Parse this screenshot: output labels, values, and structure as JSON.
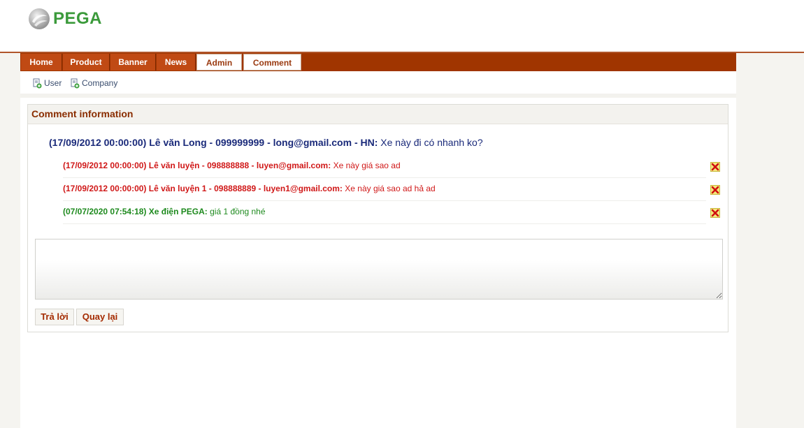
{
  "header": {
    "logo_text": "PEGA"
  },
  "nav": {
    "items": [
      {
        "label": "Home",
        "active": false
      },
      {
        "label": "Product",
        "active": false
      },
      {
        "label": "Banner",
        "active": false
      },
      {
        "label": "News",
        "active": false
      },
      {
        "label": "Admin",
        "active": true
      },
      {
        "label": "Comment",
        "active": true
      }
    ]
  },
  "subnav": {
    "items": [
      {
        "label": "User",
        "icon": "add-user-icon"
      },
      {
        "label": "Company",
        "icon": "add-company-icon"
      }
    ]
  },
  "panel": {
    "title": "Comment information",
    "main_comment": {
      "meta": "(17/09/2012 00:00:00) Lê văn Long - 099999999 - long@gmail.com - HN:",
      "text": " Xe này đi có nhanh ko?"
    },
    "replies": [
      {
        "meta": "(17/09/2012 00:00:00) Lê văn luyện - 098888888 - luyen@gmail.com:",
        "text": " Xe này giá sao ad",
        "color": "#d01818"
      },
      {
        "meta": "(17/09/2012 00:00:00) Lê văn luyện 1 - 098888889 - luyen1@gmail.com:",
        "text": " Xe này giá sao ad hả ad",
        "color": "#d01818"
      },
      {
        "meta": "(07/07/2020 07:54:18) Xe điện PEGA:",
        "text": " giá 1 đồng nhé",
        "color": "#1e8a1e"
      }
    ],
    "reply_input": {
      "value": "",
      "placeholder": ""
    },
    "buttons": {
      "reply": "Trả lời",
      "back": "Quay lại"
    }
  },
  "colors": {
    "nav_bar": "#a03500",
    "nav_item": "#c04a14",
    "accent_text": "#8a2d00",
    "main_comment": "#1a2a7a",
    "logo_green": "#3b9a3b"
  }
}
